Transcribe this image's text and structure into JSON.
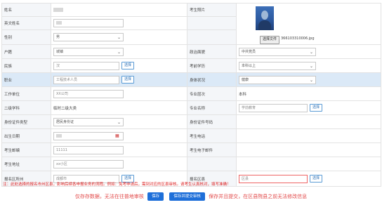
{
  "labels": {
    "name": "姓名",
    "english_name": "英文姓名",
    "gender": "性别",
    "hukou": "户籍",
    "ethnicity": "民族",
    "occupation": "职业",
    "employer": "工作单位",
    "level2": "二级学科",
    "id_type": "身份证件类型",
    "birth_date": "出生日期",
    "postcode": "考生邮编",
    "address": "考生地址",
    "reg_region": "报名区所州",
    "photo": "考生照片",
    "political": "政治面貌",
    "education": "考前学历",
    "health": "身体状况",
    "major_length": "专业层次",
    "major_name": "专业名称",
    "id_number": "身份证件号码",
    "phone": "考生电话",
    "email": "考生电子邮件",
    "district": "报名区县"
  },
  "values": {
    "gender": "男",
    "hukou": "城镇",
    "ethnicity": "汉",
    "occupation": "工程技术人员",
    "employer": "XX公司",
    "level2": "临时二级大类",
    "id_type": "居民身份证",
    "postcode": "11111",
    "address": "xx小区",
    "reg_region": "成都市",
    "political": "中共党员",
    "education": "本科以上",
    "health": "健康",
    "major_length": "本科",
    "major_name": "学前教育",
    "district_placeholder": "区县"
  },
  "photo": {
    "filename": "366103310006.jpg",
    "upload_label": "选择文件"
  },
  "pick_label": "选择",
  "notice": "注：此处选择的报名市州区县，影响后续各申报业务的流程。例如：免考申请后，需到对应的区县审核。请考生认真核对，填写准确！",
  "footer": {
    "left_text": "仅存存数据，无法在往普地审核",
    "save_label": "保存",
    "save_submit_label": "保存并提交审核",
    "right_text": "保存并且提交，在区县院县之前无法修改信息"
  },
  "colors": {
    "accent": "#1e6fd9",
    "warning": "#e24a4a",
    "highlight_row": "#dbe9f7"
  }
}
